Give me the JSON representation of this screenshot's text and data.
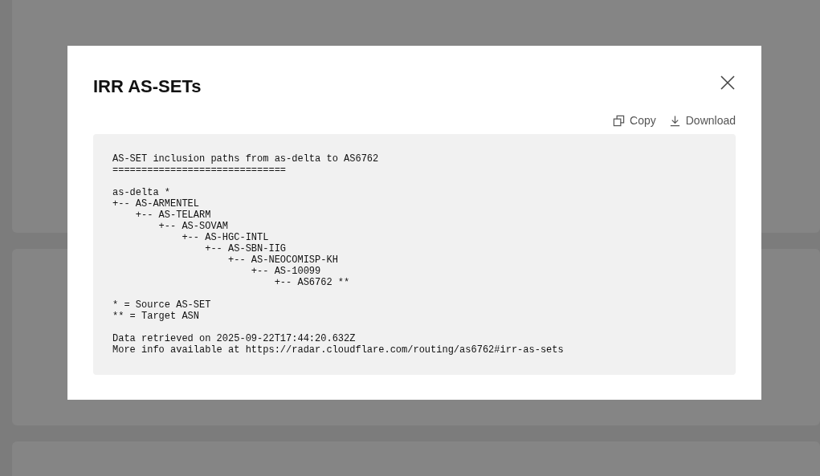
{
  "dialog": {
    "title": "IRR AS-SETs",
    "actions": [
      {
        "kind": "copy",
        "label": "Copy"
      },
      {
        "kind": "download",
        "label": "Download"
      }
    ],
    "content": [
      [
        "AS-SET inclusion paths from as-delta to AS6762",
        "=============================="
      ],
      [
        "as-delta *",
        "+-- AS-ARMENTEL",
        "    +-- AS-TELARM",
        "        +-- AS-SOVAM",
        "            +-- AS-HGC-INTL",
        "                +-- AS-SBN-IIG",
        "                    +-- AS-NEOCOMISP-KH",
        "                        +-- AS-10099",
        "                            +-- AS6762 **"
      ],
      [
        "* = Source AS-SET",
        "** = Target ASN"
      ],
      [
        "Data retrieved on 2025-09-22T17:44:20.632Z",
        "More info available at https://radar.cloudflare.com/routing/as6762#irr-as-sets"
      ]
    ]
  }
}
